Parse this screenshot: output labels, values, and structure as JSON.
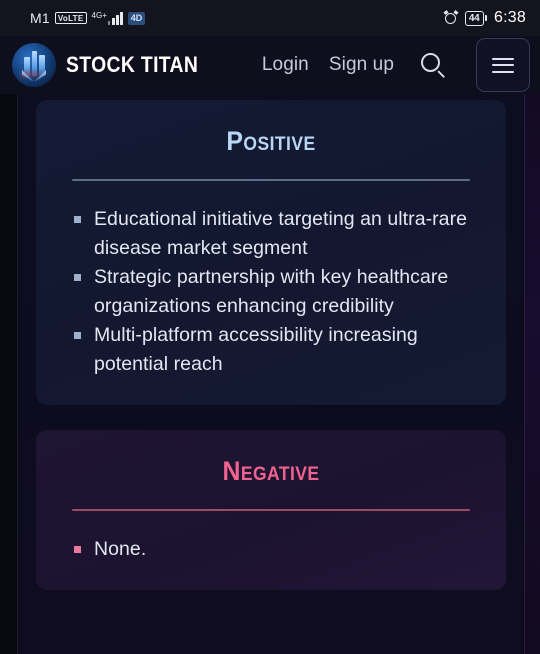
{
  "statusbar": {
    "carrier": "M1",
    "volte_badge": "VoLTE",
    "network_label": "4G+",
    "network_badge": "4D",
    "alarm_icon": "alarm-clock-icon",
    "battery_percent": "44",
    "time": "6:38"
  },
  "header": {
    "logo_icon": "stock-titan-logo-icon",
    "brand_name": "STOCK TITAN",
    "login_label": "Login",
    "signup_label": "Sign up",
    "search_icon": "search-icon",
    "menu_icon": "hamburger-menu-icon"
  },
  "cards": {
    "positive": {
      "title": "Positive",
      "accent_color": "#b9d6f5",
      "bullets": [
        "Educational initiative targeting an ultra-rare disease market segment",
        "Strategic partnership with key healthcare organizations enhancing credibility",
        "Multi-platform accessibility increasing potential reach"
      ]
    },
    "negative": {
      "title": "Negative",
      "accent_color": "#f2628f",
      "bullets": [
        "None."
      ]
    }
  }
}
